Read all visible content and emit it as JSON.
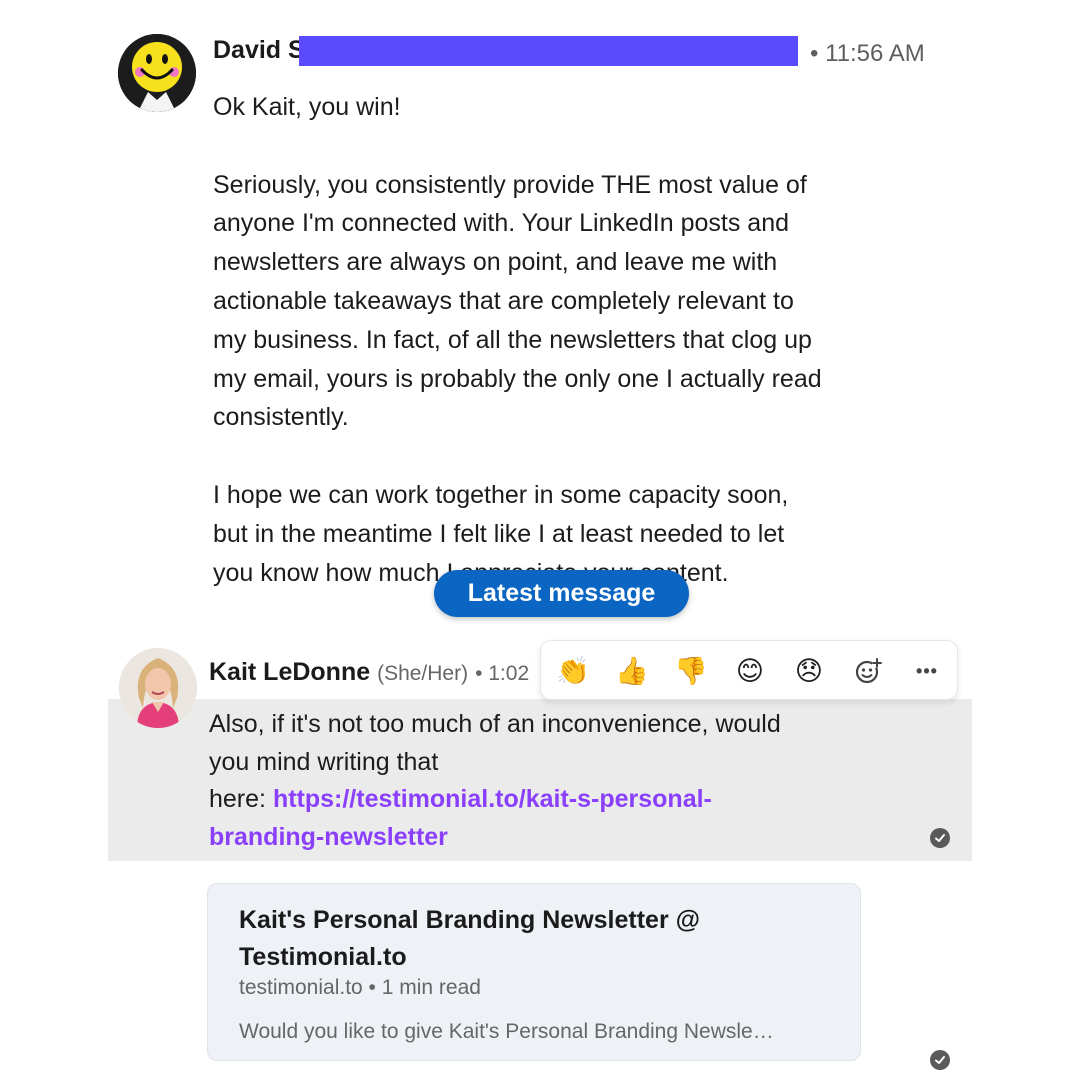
{
  "message1": {
    "sender": "David S",
    "time": "• 11:56 AM",
    "paragraphs": [
      [
        "Ok Kait, you win!"
      ],
      [
        "Seriously, you consistently provide THE most value of",
        "anyone I'm connected with. Your LinkedIn posts and",
        "newsletters are always on point, and leave me with",
        "actionable takeaways that are completely relevant to",
        "my business. In fact, of all the newsletters that clog up",
        "my email, yours is probably the only one I actually read",
        "consistently."
      ],
      [
        "I hope we can work together in some capacity soon,",
        "but in the meantime I felt like I at least needed to let",
        "you know how much I appreciate your content."
      ]
    ]
  },
  "latest_message_label": "Latest message",
  "message2": {
    "sender": "Kait LeDonne",
    "pronouns": "(She/Her)",
    "time": "• 1:02",
    "line1": "Also, if it's not too much of an inconvenience, would",
    "line2": "you mind writing that",
    "here_prefix": "here:",
    "link_line1": "https://testimonial.to/kait-s-personal-",
    "link_line2": "branding-newsletter"
  },
  "reactions": [
    {
      "icon": "clapping-hands-icon",
      "glyph": "👏"
    },
    {
      "icon": "thumbs-up-icon",
      "glyph": "👍"
    },
    {
      "icon": "thumbs-down-icon",
      "glyph": "👎"
    },
    {
      "icon": "smiling-face-icon",
      "glyph": "😊"
    },
    {
      "icon": "disappointed-face-icon",
      "glyph": "😞"
    },
    {
      "icon": "add-reaction-icon",
      "glyph": ""
    },
    {
      "icon": "more-options-icon",
      "glyph": "•••"
    }
  ],
  "preview_card": {
    "title_line1": "Kait's Personal Branding Newsletter @",
    "title_line2": "Testimonial.to",
    "meta": "testimonial.to • 1 min read",
    "description": "Would you like to give Kait's Personal Branding Newsle…"
  },
  "colors": {
    "accent": "#0a66c2",
    "link": "#8a3ffc",
    "redaction": "#5b4bff",
    "highlight": "#ebebeb"
  }
}
